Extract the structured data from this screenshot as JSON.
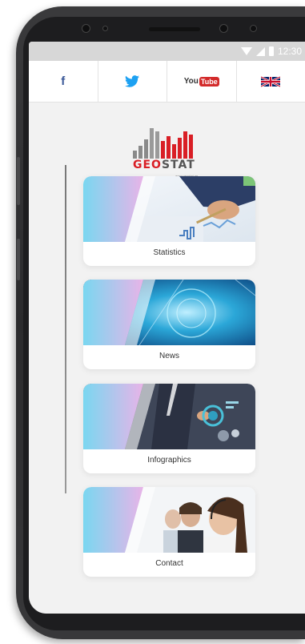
{
  "status_bar": {
    "time": "12:30"
  },
  "social": {
    "facebook_glyph": "f",
    "youtube_you": "You",
    "youtube_tube": "Tube"
  },
  "logo": {
    "word_part1": "GEO",
    "word_part2": "STAT",
    "url": "www.geostat.ge"
  },
  "menu": {
    "items": [
      {
        "label": "Statistics",
        "icon": "statistics-photo"
      },
      {
        "label": "News",
        "icon": "news-photo"
      },
      {
        "label": "Infographics",
        "icon": "infographics-photo"
      },
      {
        "label": "Contact",
        "icon": "contact-photo"
      }
    ]
  },
  "colors": {
    "brand_red": "#d91f26",
    "brand_gray": "#555555",
    "accent_cyan": "#7ad7f0",
    "accent_pink": "#e8b4e8",
    "facebook_blue": "#3b5998",
    "twitter_blue": "#1da1f2",
    "youtube_red": "#d32b2b"
  }
}
